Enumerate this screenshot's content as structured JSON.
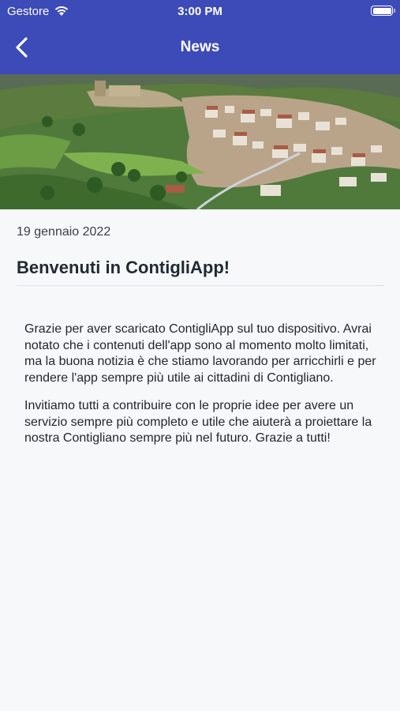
{
  "status_bar": {
    "carrier": "Gestore",
    "time": "3:00 PM"
  },
  "nav": {
    "title": "News",
    "back_icon": "chevron-left-icon"
  },
  "hero": {
    "icon": "town-aerial-photo"
  },
  "article": {
    "date": "19 gennaio 2022",
    "title": "Benvenuti in ContigliApp!",
    "paragraphs": [
      "Grazie per aver scaricato ContigliApp sul tuo dispositivo. Avrai notato che i contenuti dell'app sono al momento molto limitati, ma la buona notizia è che stiamo lavorando per arricchirli e per rendere l'app sempre più utile ai cittadini di Contigliano.",
      "Invitiamo tutti a contribuire con le proprie idee per avere un servizio sempre più completo e utile che aiuterà a proiettare la nostra Contigliano sempre più nel futuro. Grazie a tutti!"
    ]
  },
  "colors": {
    "header": "#3c4bb8",
    "background": "#f7f8f9",
    "title_text": "#1f2a35"
  }
}
